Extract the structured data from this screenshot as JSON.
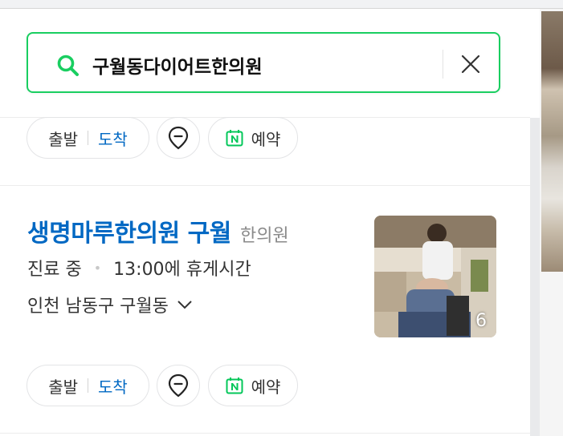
{
  "search": {
    "query": "구월동다이어트한의원"
  },
  "actions_top": {
    "start_label": "출발",
    "arrive_label": "도착",
    "booking_label": "예약"
  },
  "result": {
    "name": "생명마루한의원 구월",
    "category": "한의원",
    "status": "진료 중",
    "hours_note": "13:00에 휴게시간",
    "address": "인천 남동구 구월동",
    "photo_count": "6"
  },
  "actions_bottom": {
    "start_label": "출발",
    "arrive_label": "도착",
    "booking_label": "예약"
  },
  "colors": {
    "accent_green": "#19ce60",
    "link_blue": "#0068c3",
    "naver_badge_green": "#03c75a"
  },
  "icons": {
    "search": "search-icon",
    "clear": "close-icon",
    "pin": "map-pin-icon",
    "booking": "naver-booking-icon",
    "chevron": "chevron-down-icon"
  }
}
